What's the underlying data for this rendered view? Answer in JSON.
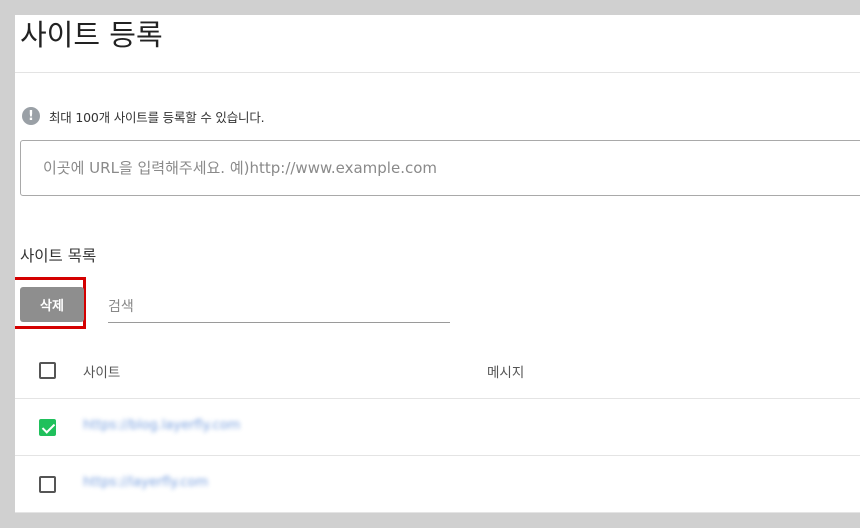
{
  "page": {
    "title": "사이트 등록",
    "notice": "최대 100개 사이트를 등록할 수 있습니다.",
    "url_input": {
      "value": "",
      "placeholder": "이곳에 URL을 입력해주세요. 예)http://www.example.com"
    }
  },
  "site_list": {
    "title": "사이트 목록",
    "delete_label": "삭제",
    "search_placeholder": "검색",
    "columns": {
      "site": "사이트",
      "message": "메시지"
    },
    "rows": [
      {
        "checked": true,
        "site": "https://blog.layerfly.com",
        "message": ""
      },
      {
        "checked": false,
        "site": "https://layerfly.com",
        "message": ""
      }
    ]
  },
  "colors": {
    "checked": "#20c05c",
    "delete_button": "#8e8e8e",
    "highlight": "#d40000",
    "link": "#4a7fd4"
  },
  "icons": {
    "notice": "info-icon"
  }
}
